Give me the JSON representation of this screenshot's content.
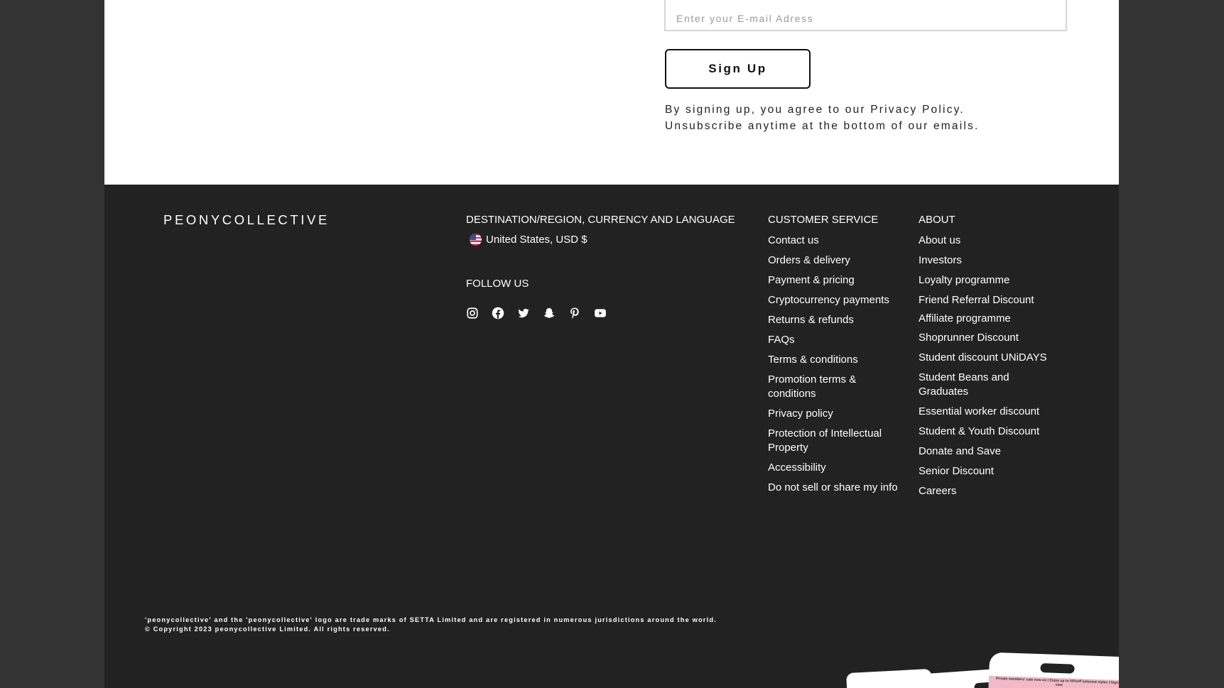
{
  "newsletter": {
    "email_placeholder": "Enter your E-mail Adress",
    "signup_label": "Sign Up",
    "consent_line1": "By signing up, you agree to our Privacy Policy.",
    "consent_line2": "Unsubscribe anytime at the bottom of our emails."
  },
  "footer": {
    "brand": "PEONYCOLLECTIVE",
    "region": {
      "heading": "DESTINATION/REGION, CURRENCY AND LANGUAGE",
      "selected": "United States, USD $",
      "flag_icon": "us-flag-icon"
    },
    "follow": {
      "heading": "FOLLOW US",
      "icons": [
        "instagram-icon",
        "facebook-icon",
        "twitter-icon",
        "snapchat-icon",
        "pinterest-icon",
        "youtube-icon"
      ]
    },
    "customer_service": {
      "heading": "CUSTOMER SERVICE",
      "links": [
        "Contact us",
        "Orders & delivery",
        "Payment & pricing",
        "Cryptocurrency payments",
        "Returns & refunds",
        "FAQs",
        "Terms & conditions",
        "Promotion terms & conditions",
        "Privacy policy",
        "Protection of Intellectual Property",
        "Accessibility",
        "Do not sell or share my info"
      ]
    },
    "about": {
      "heading": "ABOUT",
      "links": [
        "About us",
        "Investors",
        "Loyalty programme",
        "Friend Referral Discount",
        "Affiliate programme",
        "Shoprunner Discount",
        "Student discount UNiDAYS",
        "Student Beans and Graduates",
        "Essential worker discount",
        "Student & Youth Discount",
        "Donate and Save",
        "Senior Discount",
        "Careers"
      ]
    },
    "legal_line1": "'peonycollective' and the 'peonycollective' logo are trade marks of SETTA Limited and are registered in numerous jurisdictions around the world.",
    "legal_line2": "© Copyright 2023 peonycollective Limited. All rights reserved.",
    "card_text": "Private members' sale now on | Enjoy up to 50%off selected styles | Sign in now"
  }
}
